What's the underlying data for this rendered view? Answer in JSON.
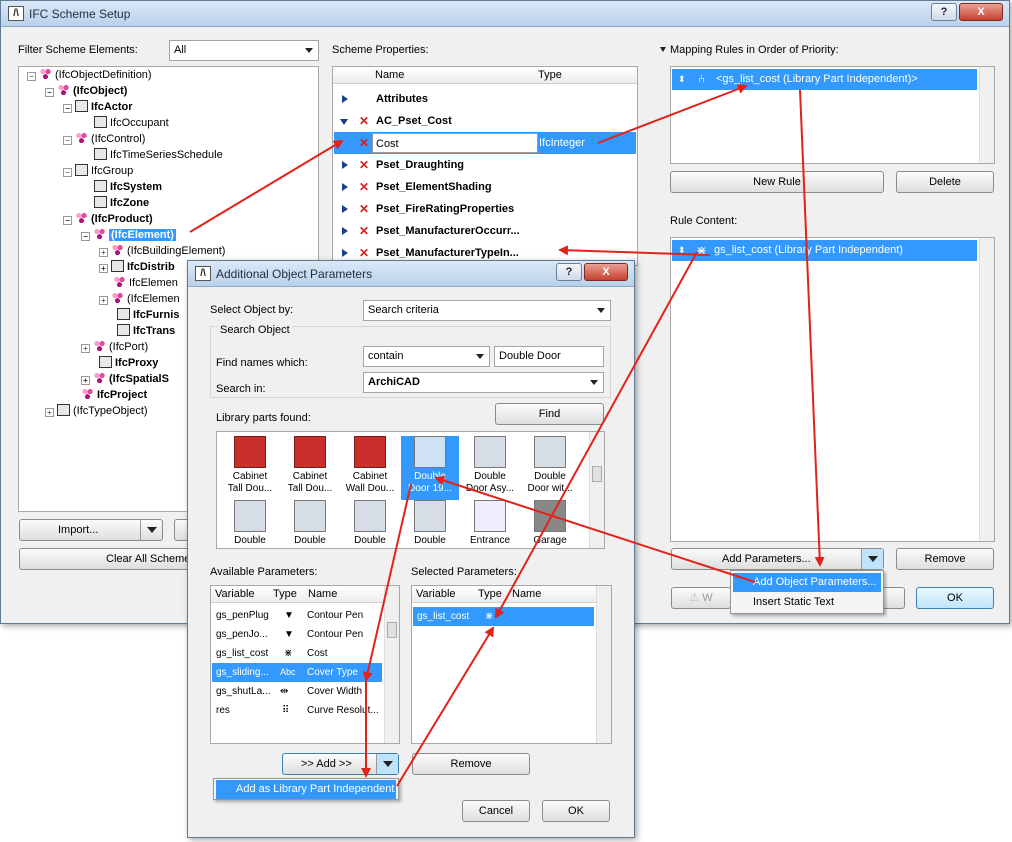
{
  "main_window": {
    "title": "IFC Scheme Setup",
    "logo": "archicad-logo-icon",
    "help_btn": "?",
    "close_btn": "X",
    "filter_label": "Filter Scheme Elements:",
    "filter_value": "All",
    "scheme_props_label": "Scheme Properties:",
    "mapping_label": "Mapping Rules in Order of Priority:",
    "rule_content_label": "Rule Content:",
    "tree": [
      {
        "label": "(IfcObjectDefinition)",
        "bold": false
      },
      {
        "label": "(IfcObject)",
        "bold": true
      },
      {
        "label": "IfcActor",
        "bold": true
      },
      {
        "label": "IfcOccupant",
        "bold": false
      },
      {
        "label": "(IfcControl)",
        "bold": false
      },
      {
        "label": "IfcTimeSeriesSchedule",
        "bold": false
      },
      {
        "label": "IfcGroup",
        "bold": false
      },
      {
        "label": "IfcSystem",
        "bold": true
      },
      {
        "label": "IfcZone",
        "bold": true
      },
      {
        "label": "(IfcProduct)",
        "bold": true
      },
      {
        "label": "(IfcElement)",
        "bold": true,
        "selected": true
      },
      {
        "label": "(IfcBuildingElement)",
        "bold": false
      },
      {
        "label": "IfcDistrib",
        "bold": true
      },
      {
        "label": "IfcElemen",
        "bold": false
      },
      {
        "label": "(IfcElemen",
        "bold": false
      },
      {
        "label": "IfcFurnis",
        "bold": true
      },
      {
        "label": "IfcTrans",
        "bold": true
      },
      {
        "label": "(IfcPort)",
        "bold": false
      },
      {
        "label": "IfcProxy",
        "bold": true
      },
      {
        "label": "(IfcSpatialS",
        "bold": true
      },
      {
        "label": "IfcProject",
        "bold": true
      },
      {
        "label": "(IfcTypeObject)",
        "bold": false
      }
    ],
    "import_btn": "Import...",
    "clear_btn": "Clear All Scheme",
    "props_headers": {
      "name": "Name",
      "type": "Type"
    },
    "props_rows": [
      {
        "name": "Attributes",
        "expanded": false,
        "x": false
      },
      {
        "name": "AC_Pset_Cost",
        "expanded": true,
        "x": true
      },
      {
        "name": "Cost",
        "type": "IfcInteger",
        "child": true
      },
      {
        "name": "Pset_Draughting",
        "expanded": false,
        "x": true
      },
      {
        "name": "Pset_ElementShading",
        "expanded": false,
        "x": true
      },
      {
        "name": "Pset_FireRatingProperties",
        "expanded": false,
        "x": true
      },
      {
        "name": "Pset_ManufacturerOccurr...",
        "expanded": false,
        "x": true
      },
      {
        "name": "Pset_ManufacturerTypeIn...",
        "expanded": false,
        "x": true
      }
    ],
    "mapping_rule": "<gs_list_cost (Library Part Independent)>",
    "new_rule_btn": "New Rule",
    "delete_btn": "Delete",
    "rule_content_item": "gs_list_cost (Library Part Independent)",
    "add_params_btn": "Add Parameters...",
    "remove_btn": "Remove",
    "ok_btn": "OK",
    "w_btn": "W",
    "menu": [
      "Add Object Parameters...",
      "Insert Static Text"
    ]
  },
  "dialog": {
    "title": "Additional Object Parameters",
    "help_btn": "?",
    "close_btn": "X",
    "select_by_label": "Select Object by:",
    "select_by_value": "Search criteria",
    "search_group": "Search Object",
    "find_names_label": "Find names which:",
    "find_mode": "contain",
    "find_text": "Double Door",
    "search_in_label": "Search in:",
    "search_in_value": "ArchiCAD",
    "found_label": "Library parts found:",
    "find_btn": "Find",
    "thumbs": [
      {
        "l1": "Cabinet",
        "l2": "Tall Dou...",
        "red": true
      },
      {
        "l1": "Cabinet",
        "l2": "Tall Dou...",
        "red": true
      },
      {
        "l1": "Cabinet",
        "l2": "Wall Dou...",
        "red": true
      },
      {
        "l1": "Double",
        "l2": "Door 19...",
        "red": false,
        "selected": true
      },
      {
        "l1": "Double",
        "l2": "Door Asy...",
        "red": false
      },
      {
        "l1": "Double",
        "l2": "Door wit...",
        "red": false
      },
      {
        "l1": "Double",
        "l2": "",
        "red": false
      },
      {
        "l1": "Double",
        "l2": "",
        "red": false
      },
      {
        "l1": "Double",
        "l2": "",
        "red": false
      },
      {
        "l1": "Double",
        "l2": "",
        "red": false
      },
      {
        "l1": "Entrance",
        "l2": "",
        "red": false
      },
      {
        "l1": "Garage",
        "l2": "",
        "red": false
      }
    ],
    "available_label": "Available Parameters:",
    "selected_label": "Selected Parameters:",
    "col_variable": "Variable",
    "col_type": "Type",
    "col_name": "Name",
    "available": [
      {
        "var": "gs_penPlug",
        "type": "pen-icon",
        "name": "Contour Pen"
      },
      {
        "var": "gs_penJo...",
        "type": "pen-icon",
        "name": "Contour Pen"
      },
      {
        "var": "gs_list_cost",
        "type": "cost-icon",
        "name": "Cost"
      },
      {
        "var": "gs_sliding...",
        "type": "Abc",
        "name": "Cover Type",
        "selected": true
      },
      {
        "var": "gs_shutLa...",
        "type": "width-icon",
        "name": "Cover Width"
      },
      {
        "var": "res",
        "type": "resolution-icon",
        "name": "Curve Resolut..."
      }
    ],
    "selected": [
      {
        "var": "gs_list_cost",
        "type": "cost-icon",
        "name": ""
      }
    ],
    "add_btn": ">> Add >>",
    "remove_btn": "Remove",
    "add_menu": "Add as Library Part Independent",
    "cancel_btn": "Cancel",
    "ok_btn": "OK"
  }
}
